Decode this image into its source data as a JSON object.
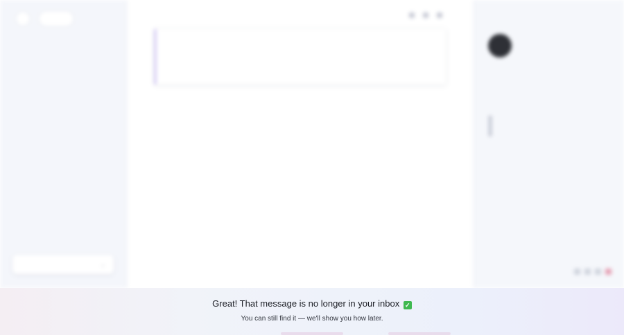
{
  "sidebar": {
    "pill_label": "",
    "search": {
      "label": "",
      "action": ""
    }
  },
  "message": {
    "subject": "",
    "sender": "",
    "date": "",
    "lines": [
      "",
      ""
    ]
  },
  "profile": {
    "title": "",
    "email": "",
    "subtitle": "",
    "address": "",
    "bio_lines": [
      "",
      "",
      ""
    ],
    "tags": [
      "",
      "",
      "",
      "",
      ""
    ],
    "footer": ""
  },
  "banner": {
    "title": "Great! That message is no longer in your inbox",
    "subtitle": "You can still find it — we'll show you how later.",
    "icon": "check-icon",
    "icon_color": "#3fb950"
  }
}
